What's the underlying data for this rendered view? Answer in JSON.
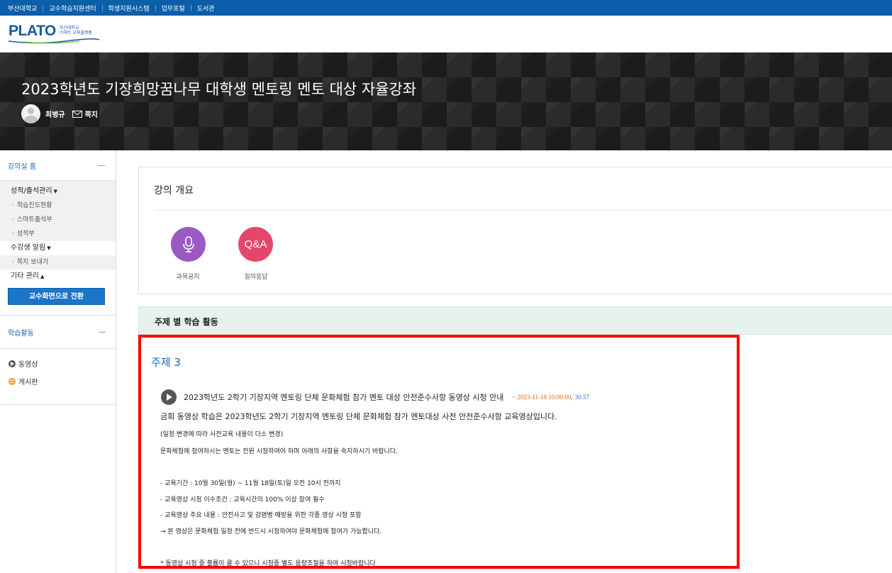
{
  "topbar": {
    "links": [
      "부산대학교",
      "교수학습지원센터",
      "학생지원시스템",
      "업무포털",
      "도서관"
    ]
  },
  "logo": {
    "word": "PLATO",
    "sub1": "부산대학교",
    "sub2": "스마트 교육플랫폼"
  },
  "course": {
    "title": "2023학년도 기장희망꿈나무 대학생 멘토링 멘토 대상 자율강좌",
    "professor": "최병규",
    "message_label": "쪽지"
  },
  "sidebar": {
    "home": "강의실 홈",
    "grades": {
      "label": "성적/출석관리",
      "items": [
        "학습진도현황",
        "스마트출석부",
        "성적부"
      ]
    },
    "notice": {
      "label": "수강생 알림",
      "items": [
        "쪽지 보내기"
      ]
    },
    "etc": {
      "label": "기타 관리"
    },
    "switch_button": "교수화면으로 전환",
    "activities": {
      "label": "학습활동",
      "items": [
        "동영상",
        "게시판"
      ]
    },
    "collapse_symbol": "—"
  },
  "overview": {
    "title": "강의 개요",
    "qa_text": "Q&A",
    "icons": [
      "과목공지",
      "질의응답"
    ]
  },
  "topics": {
    "header": "주제 별 학습 활동",
    "topic_title": "주제 3",
    "video": {
      "title": "2023학년도 2학기 기장지역 멘토링 단체 문화체험 참가 멘토 대상 안전준수사항 동영상 시청 안내",
      "date": "~ 2023-11-18 10:00:00",
      "duration": "30:57"
    },
    "lines": [
      "금회 동영상 학습은 2023학년도 2학기 기장지역 멘토링 단체 문화체험 참가 멘토대상 사전 안전준수사항 교육영상입니다.",
      "(일정 변경에 따라 사전교육 내용이 다소 변경)",
      "문화체험에 참여하시는 멘토는 전원 시청하여야 하며 아래의 사항을 숙지하시기 바랍니다.",
      "- 교육기간 : 10월 30일(월) ~ 11월 18일(토)일 오전 10시 전까지",
      "- 교육영상 시청 이수조건 : 교육시간의 100% 이상 참여 필수",
      "- 교육영상 주요 내용 : 안전사고 및 감염병 예방을 위한 각종 영상 시청 포함",
      "→ 본 영상은 문화체험 일정 전에 반드시 시청하여야 문화체험에 참여가 가능합니다.",
      "* 동영상 시청 중 볼륨이 클 수 있으니 시청중 별도 음량조절을 하여 시청바랍니다"
    ]
  },
  "colors": {
    "topbar": "#0b5ea8",
    "accent": "#1f65b8",
    "highlight": "#ff0000",
    "purple": "#9a59c4",
    "pink": "#e5476b",
    "date": "#e36414"
  }
}
